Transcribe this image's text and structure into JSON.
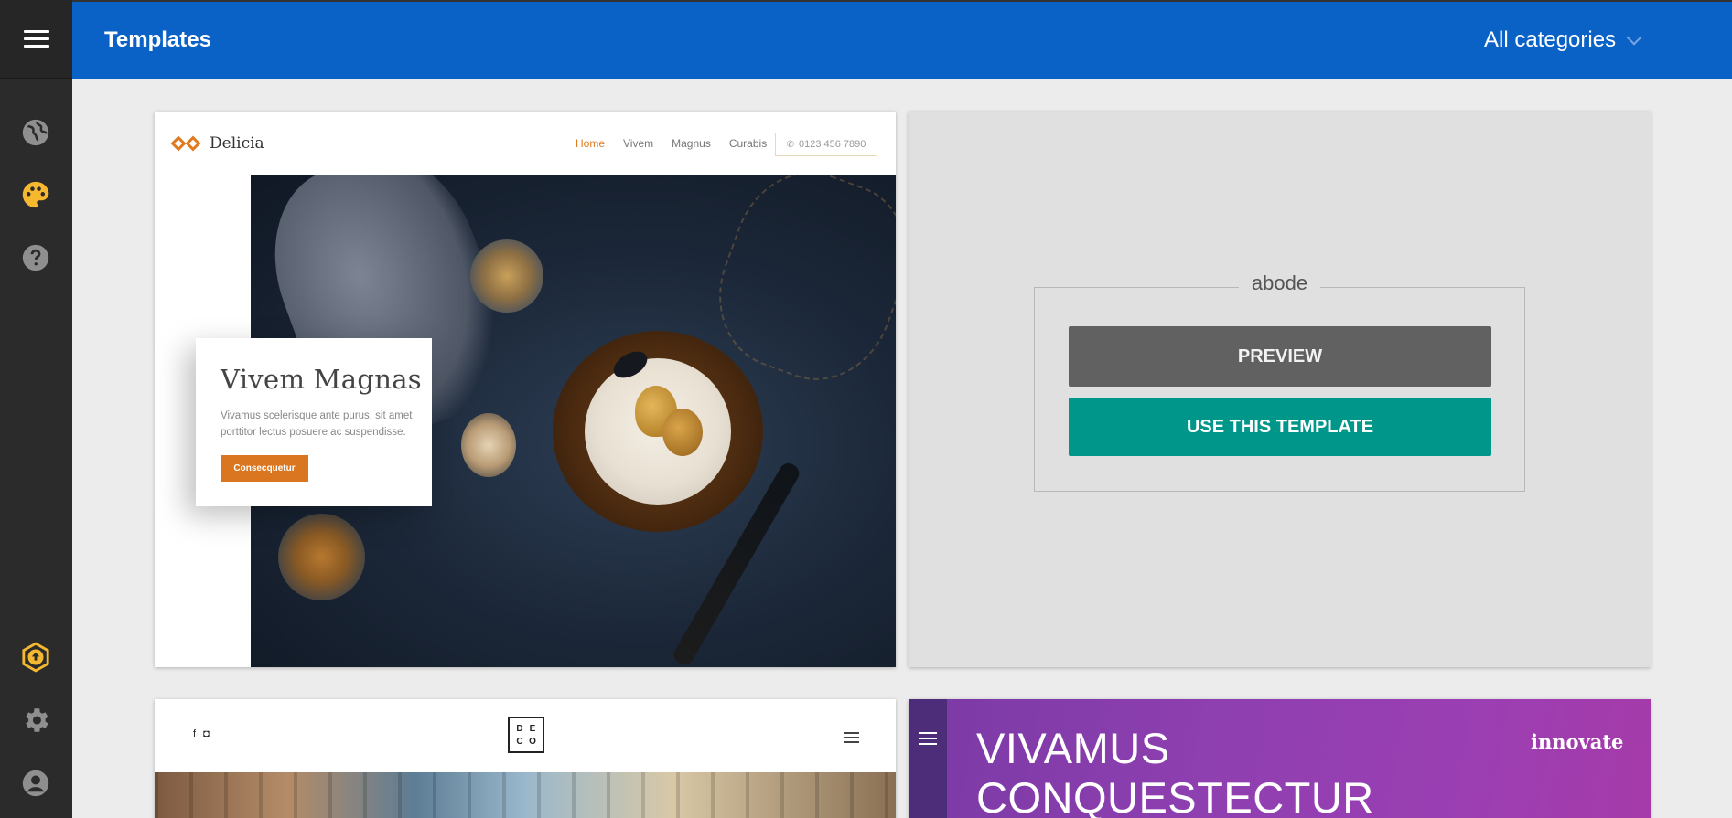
{
  "header": {
    "title": "Templates",
    "category_select": "All categories"
  },
  "sidebar": {
    "menu_icon": "hamburger-icon",
    "items": [
      {
        "icon": "globe-icon",
        "color": "#9e9e9e"
      },
      {
        "icon": "palette-icon",
        "color": "#f5b82e"
      },
      {
        "icon": "help-icon",
        "color": "#9e9e9e"
      },
      {
        "icon": "upload-icon",
        "color": "#f5b82e"
      },
      {
        "icon": "gear-icon",
        "color": "#9e9e9e"
      },
      {
        "icon": "account-icon",
        "color": "#9e9e9e"
      }
    ]
  },
  "colors": {
    "header": "#0b62c6",
    "sidebar": "#2b2b2b",
    "preview_button": "#616161",
    "use_button": "#00968a",
    "accent": "#e07b1f"
  },
  "templates": {
    "delicia": {
      "brand": "Delicia",
      "nav": [
        "Home",
        "Vivem",
        "Magnus",
        "Curabis"
      ],
      "phone": "0123 456 7890",
      "hero_title": "Vivem Magnas",
      "hero_text": "Vivamus scelerisque ante purus, sit amet porttitor lectus posuere ac suspendisse.",
      "hero_button": "Consecquetur"
    },
    "abode": {
      "name": "abode",
      "preview_label": "PREVIEW",
      "use_label": "USE THIS TEMPLATE"
    },
    "deco": {
      "social": [
        "f",
        "◘"
      ],
      "logo_letters": [
        "D",
        "E",
        "C",
        "O"
      ]
    },
    "innovate": {
      "title_line1": "VIVAMUS",
      "title_line2": "CONQUESTECTUR",
      "brand": "innovate"
    }
  }
}
